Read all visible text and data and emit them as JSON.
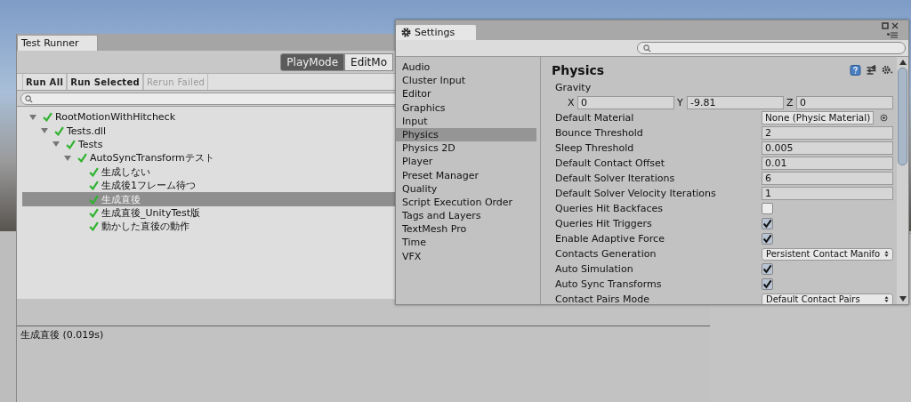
{
  "test_runner": {
    "tab": "Test Runner",
    "modes": [
      {
        "label": "PlayMode",
        "selected": true
      },
      {
        "label": "EditMo",
        "selected": false
      }
    ],
    "actions": [
      {
        "label": "Run All",
        "disabled": false
      },
      {
        "label": "Run Selected",
        "disabled": false
      },
      {
        "label": "Rerun Failed",
        "disabled": true
      }
    ],
    "tree": [
      {
        "label": "RootMotionWithHitcheck",
        "passed": true,
        "expanded": true,
        "selected": false,
        "children": [
          {
            "label": "Tests.dll",
            "passed": true,
            "expanded": true,
            "selected": false,
            "children": [
              {
                "label": "Tests",
                "passed": true,
                "expanded": true,
                "selected": false,
                "children": [
                  {
                    "label": "AutoSyncTransformテスト",
                    "passed": true,
                    "expanded": true,
                    "selected": false,
                    "children": [
                      {
                        "label": "生成しない",
                        "passed": true,
                        "selected": false
                      },
                      {
                        "label": "生成後1フレーム待つ",
                        "passed": true,
                        "selected": false
                      },
                      {
                        "label": "生成直後",
                        "passed": true,
                        "selected": true
                      },
                      {
                        "label": "生成直後_UnityTest版",
                        "passed": true,
                        "selected": false
                      },
                      {
                        "label": "動かした直後の動作",
                        "passed": true,
                        "selected": false
                      }
                    ]
                  }
                ]
              }
            ]
          }
        ]
      }
    ],
    "detail": "生成直後 (0.019s)"
  },
  "settings": {
    "tab": "Settings",
    "sidebar": [
      {
        "label": "Audio",
        "selected": false
      },
      {
        "label": "Cluster Input",
        "selected": false
      },
      {
        "label": "Editor",
        "selected": false
      },
      {
        "label": "Graphics",
        "selected": false
      },
      {
        "label": "Input",
        "selected": false
      },
      {
        "label": "Physics",
        "selected": true
      },
      {
        "label": "Physics 2D",
        "selected": false
      },
      {
        "label": "Player",
        "selected": false
      },
      {
        "label": "Preset Manager",
        "selected": false
      },
      {
        "label": "Quality",
        "selected": false
      },
      {
        "label": "Script Execution Order",
        "selected": false
      },
      {
        "label": "Tags and Layers",
        "selected": false
      },
      {
        "label": "TextMesh Pro",
        "selected": false
      },
      {
        "label": "Time",
        "selected": false
      },
      {
        "label": "VFX",
        "selected": false
      }
    ],
    "title": "Physics",
    "fields": [
      {
        "kind": "vector",
        "label": "Gravity",
        "components": [
          {
            "axis": "X",
            "value": "0"
          },
          {
            "axis": "Y",
            "value": "-9.81"
          },
          {
            "axis": "Z",
            "value": "0"
          }
        ]
      },
      {
        "kind": "object",
        "label": "Default Material",
        "value": "None (Physic Material)"
      },
      {
        "kind": "number",
        "label": "Bounce Threshold",
        "value": "2"
      },
      {
        "kind": "number",
        "label": "Sleep Threshold",
        "value": "0.005"
      },
      {
        "kind": "number",
        "label": "Default Contact Offset",
        "value": "0.01"
      },
      {
        "kind": "number",
        "label": "Default Solver Iterations",
        "value": "6"
      },
      {
        "kind": "number",
        "label": "Default Solver Velocity Iterations",
        "value": "1"
      },
      {
        "kind": "checkbox",
        "label": "Queries Hit Backfaces",
        "checked": false
      },
      {
        "kind": "checkbox",
        "label": "Queries Hit Triggers",
        "checked": true
      },
      {
        "kind": "checkbox",
        "label": "Enable Adaptive Force",
        "checked": true
      },
      {
        "kind": "dropdown",
        "label": "Contacts Generation",
        "value": "Persistent Contact Manifo"
      },
      {
        "kind": "checkbox",
        "label": "Auto Simulation",
        "checked": true
      },
      {
        "kind": "checkbox",
        "label": "Auto Sync Transforms",
        "checked": true
      },
      {
        "kind": "dropdown",
        "label": "Contact Pairs Mode",
        "value": "Default Contact Pairs"
      }
    ]
  }
}
